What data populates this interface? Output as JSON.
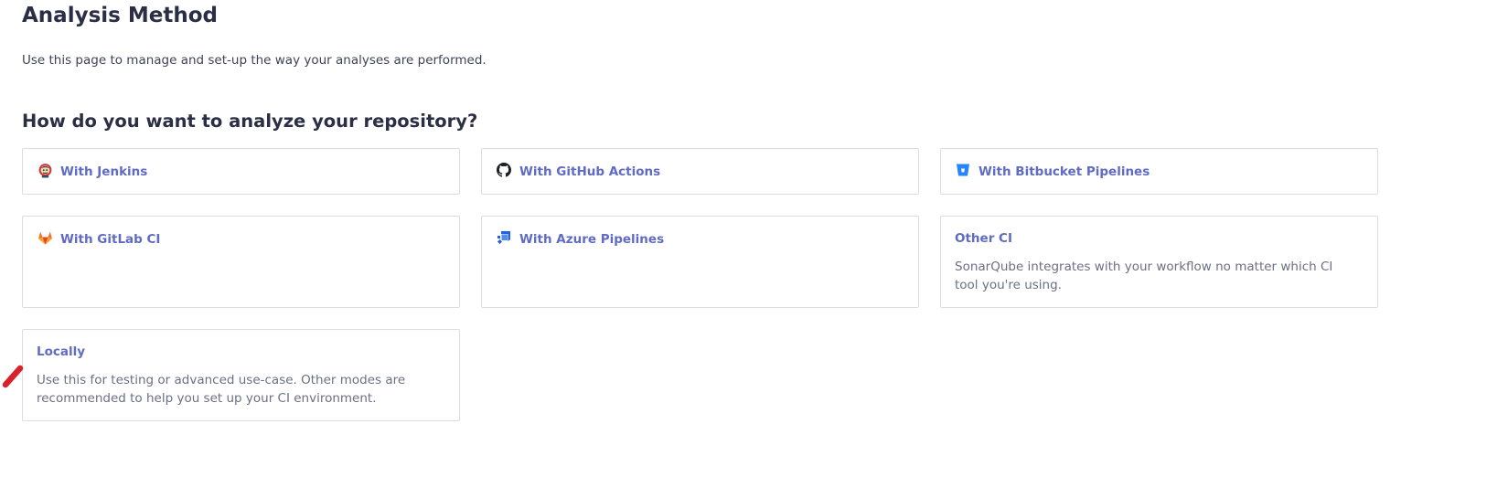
{
  "page": {
    "title": "Analysis Method",
    "description": "Use this page to manage and set-up the way your analyses are performed."
  },
  "section": {
    "title": "How do you want to analyze your repository?"
  },
  "methods": [
    {
      "label": "With Jenkins",
      "icon": "jenkins-icon"
    },
    {
      "label": "With GitHub Actions",
      "icon": "github-icon"
    },
    {
      "label": "With Bitbucket Pipelines",
      "icon": "bitbucket-icon"
    },
    {
      "label": "With GitLab CI",
      "icon": "gitlab-icon"
    },
    {
      "label": "With Azure Pipelines",
      "icon": "azure-pipelines-icon"
    },
    {
      "label": "Other CI",
      "description": "SonarQube integrates with your workflow no matter which CI tool you're using."
    },
    {
      "label": "Locally",
      "description": "Use this for testing or advanced use-case. Other modes are recommended to help you set up your CI environment."
    }
  ],
  "colors": {
    "link": "#5f6bc4",
    "border": "#dcdde3",
    "heading": "#2a2f45",
    "muted_text": "#6a7085",
    "annotation_mark": "#d9202b"
  }
}
